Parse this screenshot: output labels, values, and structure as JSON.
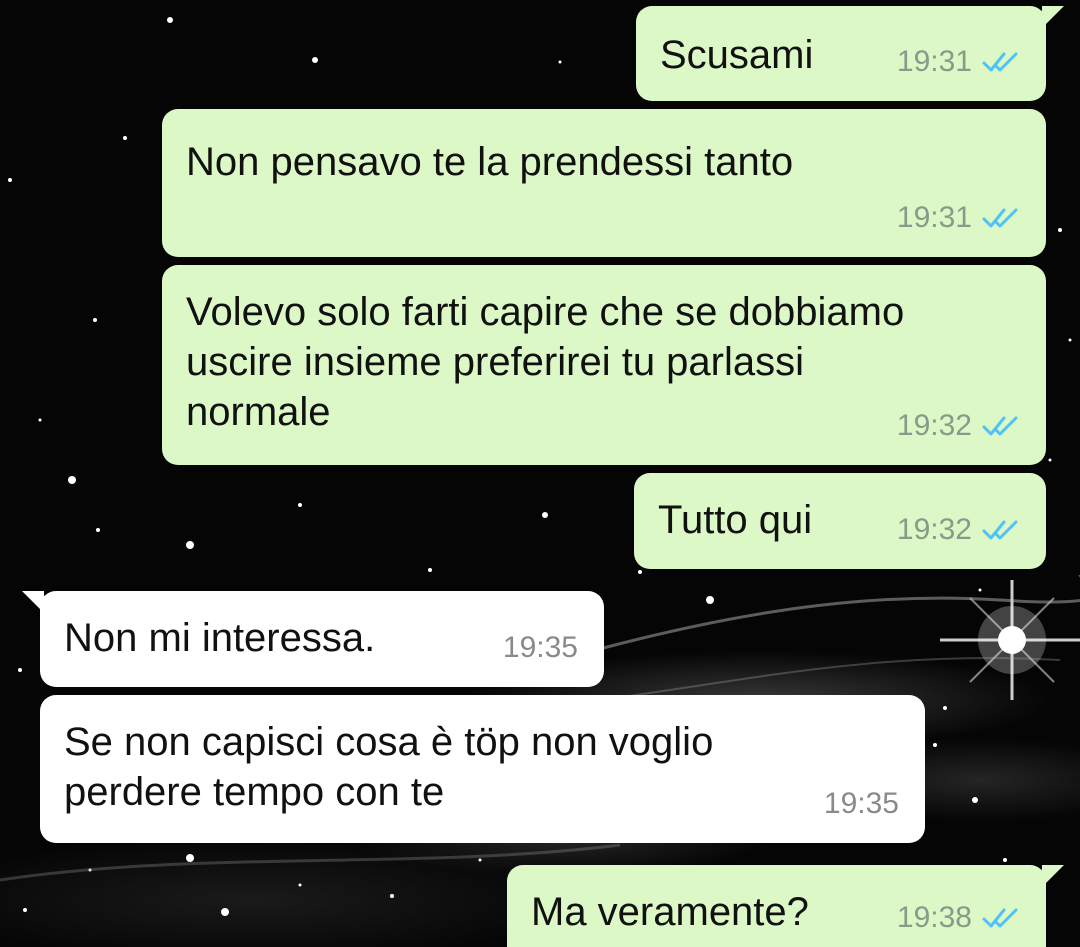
{
  "messages": [
    {
      "text": "Scusami",
      "time": "19:31",
      "direction": "outgoing",
      "status": "read"
    },
    {
      "text": "Non pensavo te la prendessi tanto",
      "time": "19:31",
      "direction": "outgoing",
      "status": "read"
    },
    {
      "text": "Volevo solo farti capire che se dobbiamo\nuscire insieme preferirei tu parlassi\nnormale",
      "time": "19:32",
      "direction": "outgoing",
      "status": "read"
    },
    {
      "text": "Tutto qui",
      "time": "19:32",
      "direction": "outgoing",
      "status": "read"
    },
    {
      "text": "Non mi interessa.",
      "time": "19:35",
      "direction": "incoming"
    },
    {
      "text": "Se non capisci cosa è töp non voglio\nperdere tempo con te",
      "time": "19:35",
      "direction": "incoming"
    },
    {
      "text": "Ma veramente?",
      "time": "19:38",
      "direction": "outgoing",
      "status": "read"
    }
  ],
  "colors": {
    "outgoing_bubble": "#dcf8c6",
    "incoming_bubble": "#ffffff",
    "read_ticks": "#4fc3f7",
    "background": "#050505"
  },
  "icons": {
    "read_status": "double-check-icon",
    "background": "starfield-wallpaper"
  }
}
